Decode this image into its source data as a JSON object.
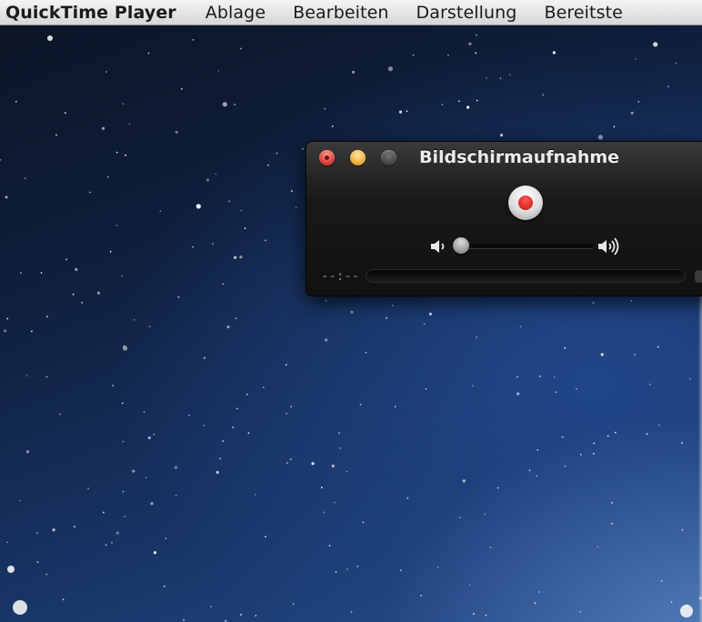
{
  "menubar": {
    "app_name": "QuickTime Player",
    "items": [
      {
        "label": "Ablage"
      },
      {
        "label": "Bearbeiten"
      },
      {
        "label": "Darstellung"
      },
      {
        "label": "Bereitste"
      }
    ]
  },
  "recording_window": {
    "title": "Bildschirmaufnahme",
    "record_color": "#d8261c",
    "volume_level": 0.0,
    "elapsed_time": "--:--",
    "icons": {
      "volume_low": "speaker-low-icon",
      "volume_high": "speaker-high-icon"
    }
  },
  "desktop": {
    "wallpaper": "starfield"
  }
}
